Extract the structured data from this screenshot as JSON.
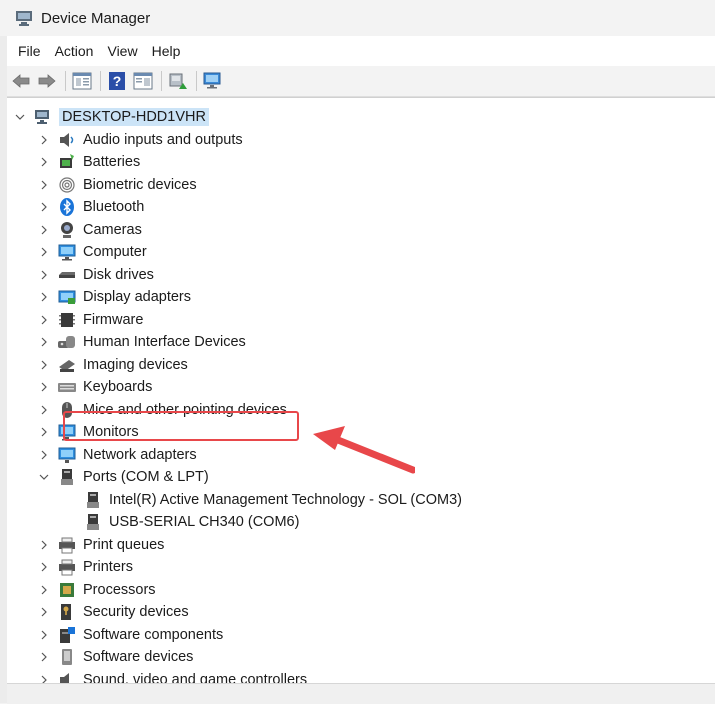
{
  "window": {
    "title": "Device Manager",
    "icon": "device-manager-icon"
  },
  "menu": [
    "File",
    "Action",
    "View",
    "Help"
  ],
  "toolbar": {
    "buttons": [
      "back-arrow-icon",
      "forward-arrow-icon",
      "properties-icon",
      "help-icon",
      "view-icon",
      "update-driver-icon",
      "scan-hardware-icon"
    ]
  },
  "tree": {
    "root": "DESKTOP-HDD1VHR",
    "categories": [
      {
        "label": "Audio inputs and outputs",
        "icon": "speaker-icon",
        "expanded": false
      },
      {
        "label": "Batteries",
        "icon": "battery-icon",
        "expanded": false
      },
      {
        "label": "Biometric devices",
        "icon": "fingerprint-icon",
        "expanded": false
      },
      {
        "label": "Bluetooth",
        "icon": "bluetooth-icon",
        "expanded": false
      },
      {
        "label": "Cameras",
        "icon": "camera-icon",
        "expanded": false
      },
      {
        "label": "Computer",
        "icon": "computer-icon",
        "expanded": false
      },
      {
        "label": "Disk drives",
        "icon": "disk-drive-icon",
        "expanded": false
      },
      {
        "label": "Display adapters",
        "icon": "display-adapter-icon",
        "expanded": false
      },
      {
        "label": "Firmware",
        "icon": "firmware-chip-icon",
        "expanded": false
      },
      {
        "label": "Human Interface Devices",
        "icon": "hid-icon",
        "expanded": false
      },
      {
        "label": "Imaging devices",
        "icon": "imaging-icon",
        "expanded": false
      },
      {
        "label": "Keyboards",
        "icon": "keyboard-icon",
        "expanded": false
      },
      {
        "label": "Mice and other pointing devices",
        "icon": "mouse-icon",
        "expanded": false
      },
      {
        "label": "Monitors",
        "icon": "monitor-icon",
        "expanded": false
      },
      {
        "label": "Network adapters",
        "icon": "network-adapter-icon",
        "expanded": false
      },
      {
        "label": "Ports (COM & LPT)",
        "icon": "port-icon",
        "expanded": true,
        "children": [
          {
            "label": "Intel(R) Active Management Technology - SOL (COM3)",
            "icon": "port-icon"
          },
          {
            "label": "USB-SERIAL CH340 (COM6)",
            "icon": "port-icon",
            "highlighted": true
          }
        ]
      },
      {
        "label": "Print queues",
        "icon": "print-queue-icon",
        "expanded": false
      },
      {
        "label": "Printers",
        "icon": "printer-icon",
        "expanded": false
      },
      {
        "label": "Processors",
        "icon": "processor-icon",
        "expanded": false
      },
      {
        "label": "Security devices",
        "icon": "security-device-icon",
        "expanded": false
      },
      {
        "label": "Software components",
        "icon": "software-component-icon",
        "expanded": false
      },
      {
        "label": "Software devices",
        "icon": "software-device-icon",
        "expanded": false
      },
      {
        "label": "Sound, video and game controllers",
        "icon": "sound-icon",
        "expanded": false
      }
    ]
  },
  "annotation": {
    "color": "#e8474a"
  }
}
